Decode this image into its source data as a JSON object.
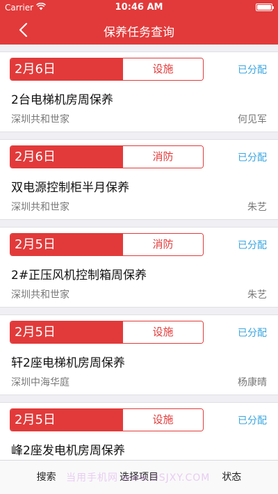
{
  "status_bar": {
    "carrier": "Carrier",
    "time": "10:46 AM",
    "wifi_icon": "wifi-icon",
    "battery_icon": "battery-icon"
  },
  "nav": {
    "title": "保养任务查询",
    "back_icon": "chevron-left-icon"
  },
  "tasks": [
    {
      "date": "2月6日",
      "category": "设施",
      "status": "已分配",
      "name": "2台电梯机房周保养",
      "project": "深圳共和世家",
      "person": "何见军"
    },
    {
      "date": "2月6日",
      "category": "消防",
      "status": "已分配",
      "name": "双电源控制柜半月保养",
      "project": "深圳共和世家",
      "person": "朱艺"
    },
    {
      "date": "2月5日",
      "category": "消防",
      "status": "已分配",
      "name": "2#正压风机控制箱周保养",
      "project": "深圳共和世家",
      "person": "朱艺"
    },
    {
      "date": "2月5日",
      "category": "设施",
      "status": "已分配",
      "name": "轩2座电梯机房周保养",
      "project": "深圳中海华庭",
      "person": "杨康晴"
    },
    {
      "date": "2月5日",
      "category": "设施",
      "status": "已分配",
      "name": "峰2座发电机房周保养",
      "project": "",
      "person": ""
    }
  ],
  "toolbar": {
    "search": "搜索",
    "select_project": "选择项目",
    "status": "状态",
    "watermark": "当用手机网 www.DSJXY.COM"
  },
  "colors": {
    "primary_red": "#e23a3a",
    "status_blue": "#3aa6e0"
  }
}
